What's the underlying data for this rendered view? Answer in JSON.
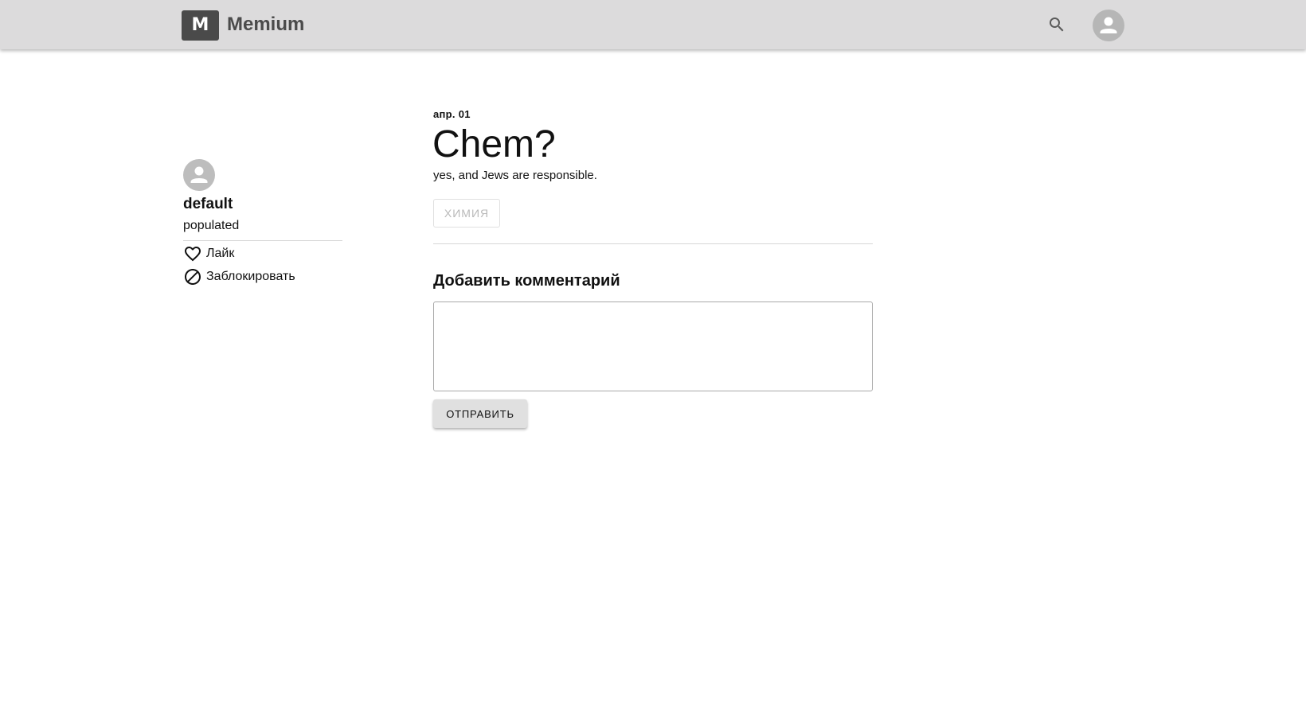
{
  "header": {
    "logo_letter": "M",
    "app_name": "Memium",
    "icons": {
      "search": "search-icon",
      "account": "account-icon"
    }
  },
  "sidebar": {
    "author_name": "default",
    "author_subtitle": "populated",
    "actions": [
      {
        "label": "Лайк",
        "icon": "heart-outline-icon"
      },
      {
        "label": "Заблокировать",
        "icon": "block-icon"
      }
    ]
  },
  "post": {
    "date": "апр. 01",
    "title": "Chem?",
    "body": "yes, and Jews are responsible.",
    "tags": [
      "ХИМИЯ"
    ]
  },
  "comments": {
    "heading": "Добавить комментарий",
    "input_value": "",
    "submit_label": "ОТПРАВИТЬ"
  },
  "colors": {
    "header_bg": "#dcdbdc",
    "logo_bg": "#4a4a4a",
    "button_bg": "#e0e0e0",
    "avatar_bg": "#bdbdbd"
  }
}
